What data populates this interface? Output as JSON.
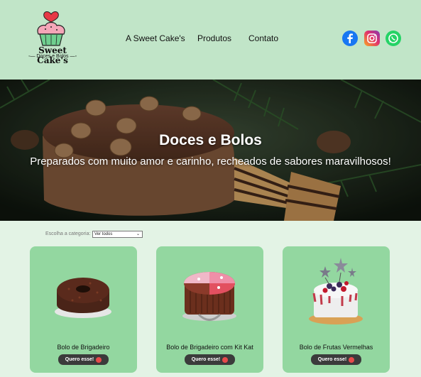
{
  "brand": {
    "name": "Sweet Cake's",
    "tagline": "Doces e Bolos"
  },
  "nav": {
    "items": [
      {
        "label": "A Sweet Cake's"
      },
      {
        "label": "Produtos"
      },
      {
        "label": "Contato"
      }
    ]
  },
  "social": [
    {
      "icon": "facebook-icon",
      "color": "#1877f2"
    },
    {
      "icon": "instagram-icon",
      "color": "#e1306c"
    },
    {
      "icon": "whatsapp-icon",
      "color": "#25d366"
    }
  ],
  "hero": {
    "title": "Doces e Bolos",
    "subtitle": "Preparados com muito amor e carinho, recheados de sabores maravilhosos!"
  },
  "filter": {
    "label": "Escolha a categoria:",
    "selected": "Ver todos"
  },
  "products": [
    {
      "name": "Bolo de Brigadeiro",
      "button": "Quero esse!"
    },
    {
      "name": "Bolo de Brigadeiro com Kit Kat",
      "button": "Quero esse!"
    },
    {
      "name": "Bolo de Frutas Vermelhas",
      "button": "Quero esse!"
    }
  ],
  "colors": {
    "header_bg": "#c1e5c8",
    "page_bg": "#e3f3e5",
    "card_bg": "#93d7a0",
    "button_bg": "#3b3b3b"
  }
}
